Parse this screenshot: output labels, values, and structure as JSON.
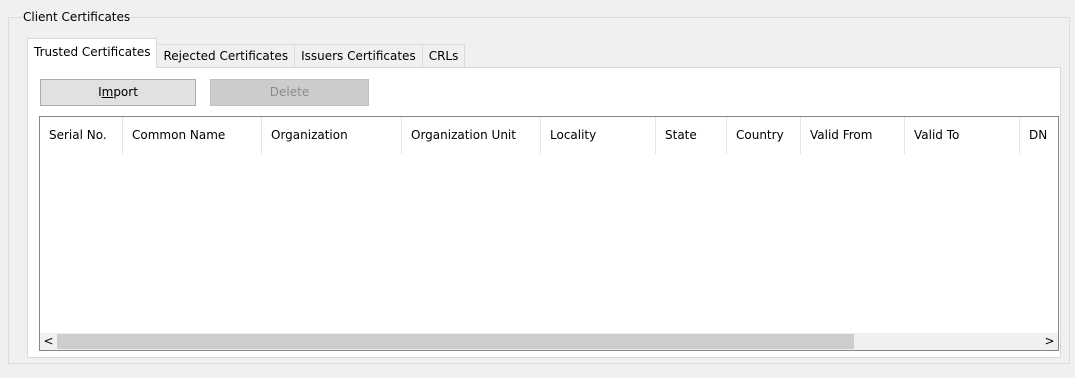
{
  "group": {
    "title": "Client Certificates"
  },
  "tabs": [
    {
      "label": "Trusted Certificates",
      "active": true
    },
    {
      "label": "Rejected Certificates",
      "active": false
    },
    {
      "label": "Issuers Certificates",
      "active": false
    },
    {
      "label": "CRLs",
      "active": false
    }
  ],
  "toolbar": {
    "import_label_pre": "I",
    "import_label_accel": "m",
    "import_label_post": "port",
    "delete_label": "Delete",
    "delete_enabled": false
  },
  "table": {
    "columns": [
      "Serial No.",
      "Common Name",
      "Organization",
      "Organization Unit",
      "Locality",
      "State",
      "Country",
      "Valid From",
      "Valid To",
      "DN"
    ],
    "rows": []
  },
  "scrollbar": {
    "left_arrow": "<",
    "right_arrow": ">",
    "position_fraction": 0.0,
    "visible_fraction": 0.81
  },
  "colors": {
    "window_bg": "#f0f0f0",
    "panel_bg": "#ffffff",
    "border": "#d9d9d9",
    "disabled_text": "#8a8a8a"
  }
}
